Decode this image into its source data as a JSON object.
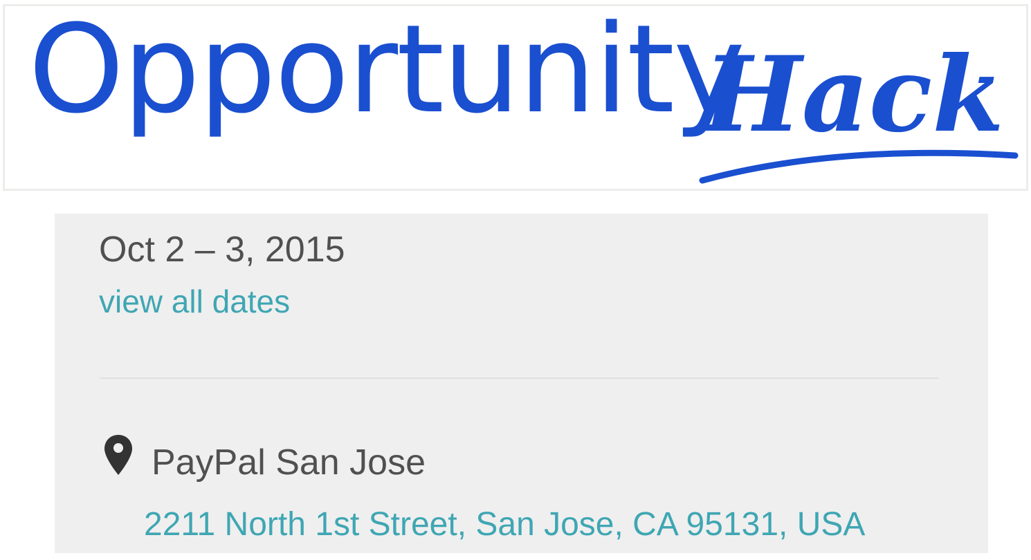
{
  "logo": {
    "word_regular": "Opportunity",
    "word_script": "Hack",
    "brand_color": "#1a4fd0"
  },
  "event": {
    "date": "Oct 2 – 3, 2015",
    "view_dates_label": "view all dates",
    "venue": "PayPal San Jose",
    "address": "2211 North 1st Street, San Jose, CA 95131, USA",
    "location_icon": "map-pin-icon",
    "link_color": "#3fa6b3",
    "text_color": "#505050",
    "card_background": "#efefef"
  }
}
